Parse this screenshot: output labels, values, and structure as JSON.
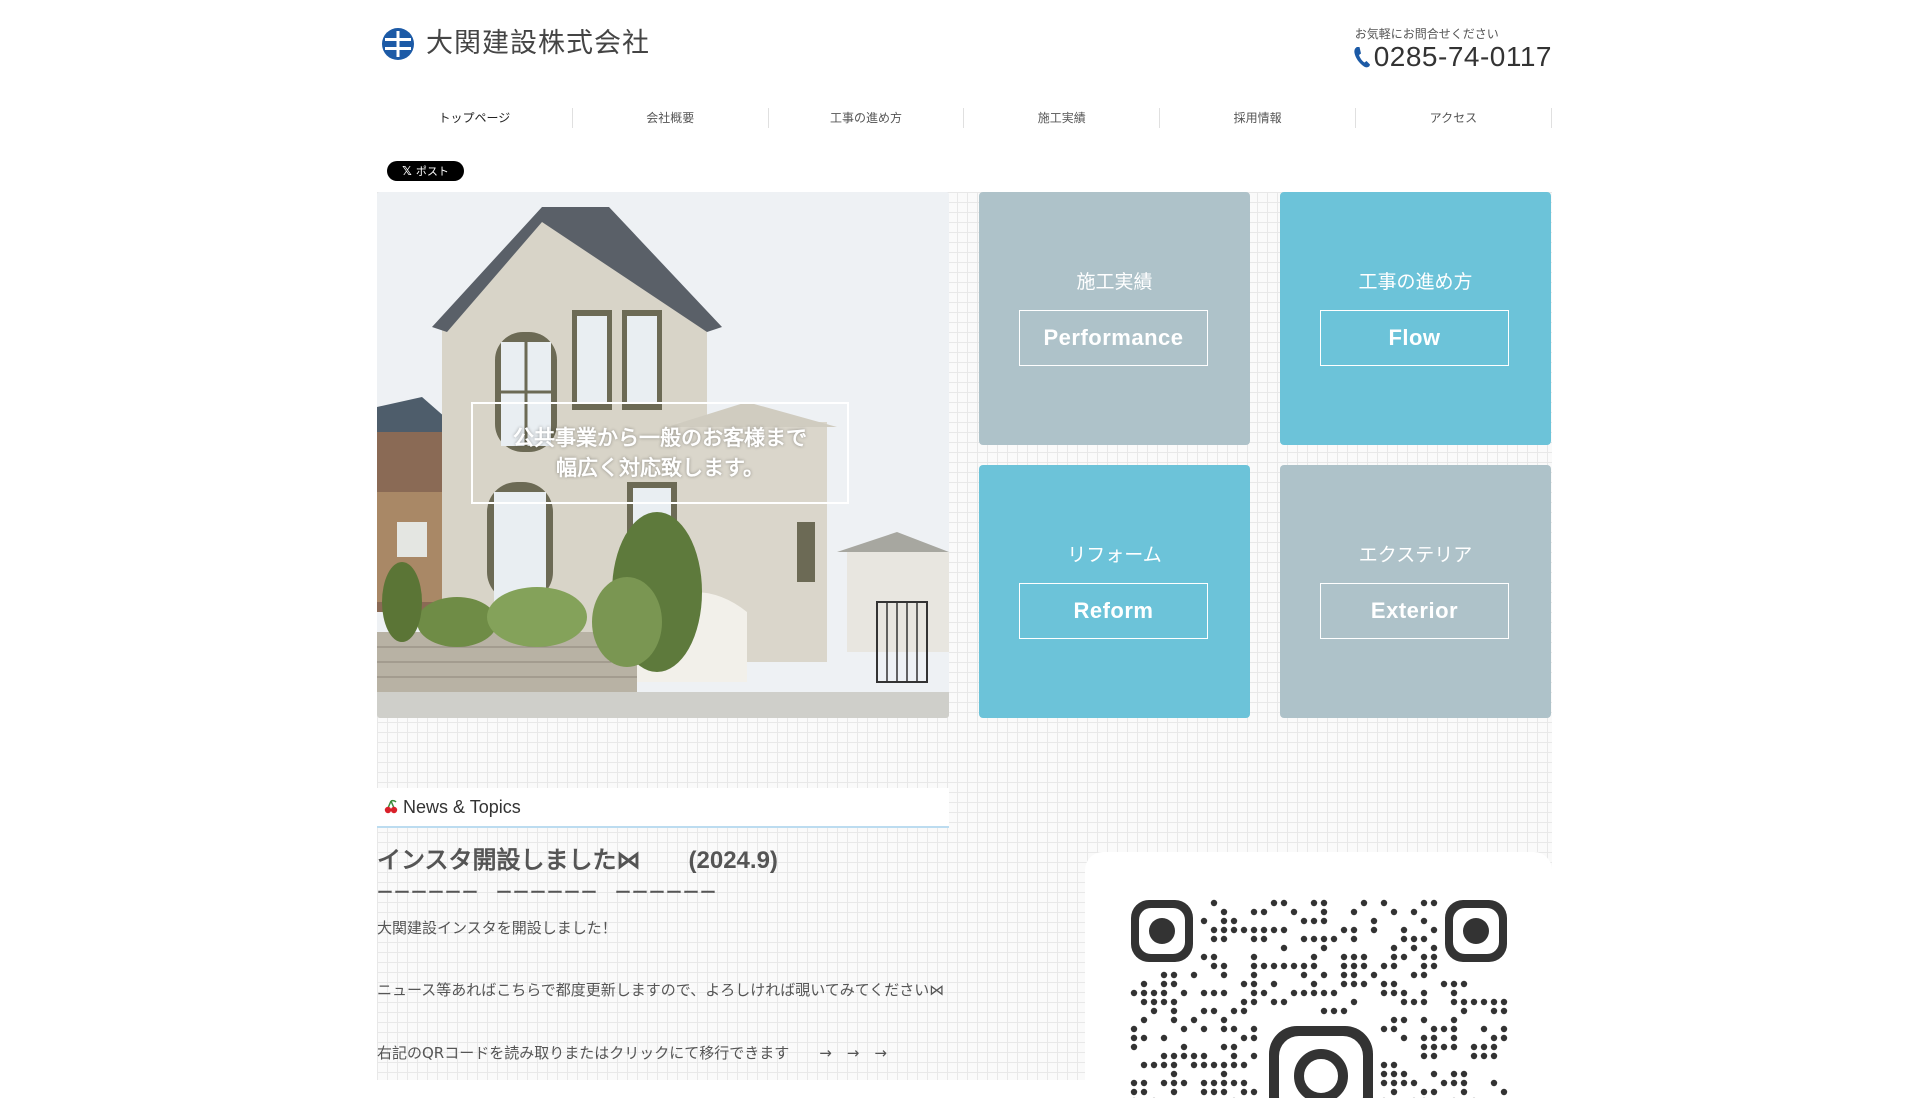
{
  "header": {
    "company_name": "大関建設株式会社",
    "contact_note": "お気軽にお問合せください",
    "phone": "0285-74-0117"
  },
  "nav": {
    "items": [
      {
        "label": "トップページ"
      },
      {
        "label": "会社概要"
      },
      {
        "label": "工事の進め方"
      },
      {
        "label": "施工実績"
      },
      {
        "label": "採用情報"
      },
      {
        "label": "アクセス"
      }
    ]
  },
  "share": {
    "label": "ポスト",
    "icon": "x-logo-icon"
  },
  "hero": {
    "caption_line1": "公共事業から一般のお客様まで",
    "caption_line2": "幅広く対応致します。"
  },
  "tiles": [
    {
      "jp": "施工実績",
      "en": "Performance",
      "color": "#aec2c9"
    },
    {
      "jp": "工事の進め方",
      "en": "Flow",
      "color": "#6cc3d9"
    },
    {
      "jp": "リフォーム",
      "en": "Reform",
      "color": "#6cc3d9"
    },
    {
      "jp": "エクステリア",
      "en": "Exterior",
      "color": "#aec2c9"
    }
  ],
  "news": {
    "heading": "News & Topics",
    "title": "インスタ開設しました⋈　　(2024.9)",
    "rule": "ーーーーーー　ーーーーーー　ーーーーーー",
    "p1": "大関建設インスタを開設しました！",
    "p2": "ニュース等あればこちらで都度更新しますので、よろしければ覗いてみてください⋈",
    "p3": "右記のQRコードを読み取りまたはクリックにて移行できます　　→　→　→"
  },
  "colors": {
    "brand_blue": "#1c5aa6",
    "tile_gray": "#aec2c9",
    "tile_blue": "#6cc3d9",
    "news_underline": "#bcdcf0"
  }
}
